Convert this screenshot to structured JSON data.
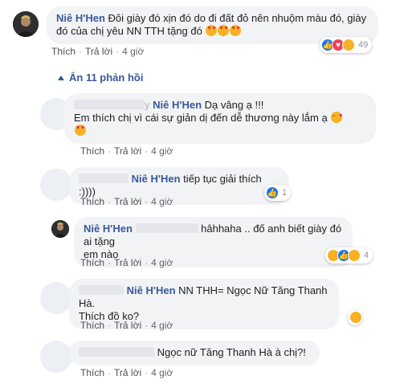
{
  "top_comment": {
    "author": "Niê H'Hen",
    "text": "Đôi giày đó xịn đó do đi đất đỏ nên nhuộm màu đó, giày đó của chị yêu NN TTH tặng đó",
    "like_label": "Thích",
    "reply_label": "Trả lời",
    "time": "4 giờ",
    "reaction_count": "49",
    "reactions": [
      "like",
      "love",
      "haha"
    ]
  },
  "hide_replies_label": "Ẩn 11 phản hồi",
  "replies": [
    {
      "author_visible": "y",
      "mention": "Niê H'Hen",
      "text_line1": "Dạ vâng ạ !!!",
      "text_line2": "Em thích chị vì cái sự giản dị đến dễ thương này lắm ạ",
      "like_label": "Thích",
      "reply_label": "Trả lời",
      "time": "4 giờ"
    },
    {
      "mention": "Niê H'Hen",
      "text": "tiếp tục giải thích :))))",
      "like_label": "Thích",
      "reply_label": "Trả lời",
      "time": "4 giờ",
      "reaction_count": "1",
      "reactions": [
        "like"
      ]
    },
    {
      "author": "Niê H'Hen",
      "text_line1": "hâhhaha .. đố anh biết giày đó ai tặng",
      "text_line2": "em nào",
      "like_label": "Thích",
      "reply_label": "Trả lời",
      "time": "4 giờ",
      "reaction_count": "4",
      "reactions": [
        "haha",
        "like",
        "wow"
      ]
    },
    {
      "mention": "Niê H'Hen",
      "text_line1": "NN THH= Ngọc Nữ Tăng Thanh Hà.",
      "text_line2": "Thích đồ ko?",
      "like_label": "Thích",
      "reply_label": "Trả lời",
      "time": "4 giờ",
      "reactions": [
        "haha"
      ]
    },
    {
      "text": "Ngọc nữ Tăng Thanh Hà à chị?!",
      "like_label": "Thích",
      "reply_label": "Trả lời",
      "time": "4 giờ"
    }
  ],
  "colors": {
    "link": "#385898",
    "bubble": "#f2f3f5",
    "like": "#1877f2",
    "love": "#f33e58",
    "haha": "#f7b125"
  }
}
